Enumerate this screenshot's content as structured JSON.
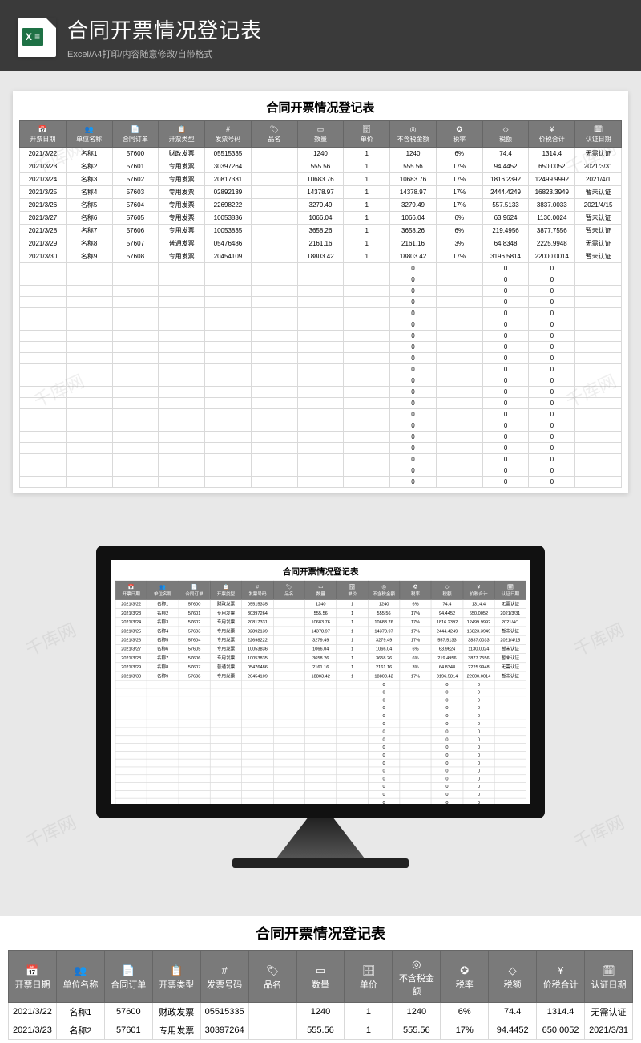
{
  "product": {
    "title": "合同开票情况登记表",
    "subtitle": "Excel/A4打印/内容随意修改/自带格式",
    "badge_text": "X ≡"
  },
  "sheet": {
    "title": "合同开票情况登记表",
    "columns": [
      {
        "icon": "📅",
        "label": "开票日期"
      },
      {
        "icon": "👥",
        "label": "单位名称"
      },
      {
        "icon": "📄",
        "label": "合同订单"
      },
      {
        "icon": "📋",
        "label": "开票类型"
      },
      {
        "icon": "#",
        "label": "发票号码"
      },
      {
        "icon": "🏷",
        "label": "品名"
      },
      {
        "icon": "▭",
        "label": "数量"
      },
      {
        "icon": "🗄",
        "label": "单价"
      },
      {
        "icon": "◎",
        "label": "不含税金额"
      },
      {
        "icon": "✪",
        "label": "税率"
      },
      {
        "icon": "◇",
        "label": "税额"
      },
      {
        "icon": "¥",
        "label": "价税合计"
      },
      {
        "icon": "🗓",
        "label": "认证日期"
      }
    ],
    "rows": [
      {
        "date": "2021/3/22",
        "unit": "名称1",
        "order": "57600",
        "type": "财政发票",
        "inv": "05515335",
        "name": "",
        "qty": "1240",
        "price": "1",
        "amt": "1240",
        "rate": "6%",
        "tax": "74.4",
        "total": "1314.4",
        "cert": "无需认证"
      },
      {
        "date": "2021/3/23",
        "unit": "名称2",
        "order": "57601",
        "type": "专用发票",
        "inv": "30397264",
        "name": "",
        "qty": "555.56",
        "price": "1",
        "amt": "555.56",
        "rate": "17%",
        "tax": "94.4452",
        "total": "650.0052",
        "cert": "2021/3/31"
      },
      {
        "date": "2021/3/24",
        "unit": "名称3",
        "order": "57602",
        "type": "专用发票",
        "inv": "20817331",
        "name": "",
        "qty": "10683.76",
        "price": "1",
        "amt": "10683.76",
        "rate": "17%",
        "tax": "1816.2392",
        "total": "12499.9992",
        "cert": "2021/4/1"
      },
      {
        "date": "2021/3/25",
        "unit": "名称4",
        "order": "57603",
        "type": "专用发票",
        "inv": "02892139",
        "name": "",
        "qty": "14378.97",
        "price": "1",
        "amt": "14378.97",
        "rate": "17%",
        "tax": "2444.4249",
        "total": "16823.3949",
        "cert": "暂未认证"
      },
      {
        "date": "2021/3/26",
        "unit": "名称5",
        "order": "57604",
        "type": "专用发票",
        "inv": "22698222",
        "name": "",
        "qty": "3279.49",
        "price": "1",
        "amt": "3279.49",
        "rate": "17%",
        "tax": "557.5133",
        "total": "3837.0033",
        "cert": "2021/4/15"
      },
      {
        "date": "2021/3/27",
        "unit": "名称6",
        "order": "57605",
        "type": "专用发票",
        "inv": "10053836",
        "name": "",
        "qty": "1066.04",
        "price": "1",
        "amt": "1066.04",
        "rate": "6%",
        "tax": "63.9624",
        "total": "1130.0024",
        "cert": "暂未认证"
      },
      {
        "date": "2021/3/28",
        "unit": "名称7",
        "order": "57606",
        "type": "专用发票",
        "inv": "10053835",
        "name": "",
        "qty": "3658.26",
        "price": "1",
        "amt": "3658.26",
        "rate": "6%",
        "tax": "219.4956",
        "total": "3877.7556",
        "cert": "暂未认证"
      },
      {
        "date": "2021/3/29",
        "unit": "名称8",
        "order": "57607",
        "type": "普通发票",
        "inv": "05476486",
        "name": "",
        "qty": "2161.16",
        "price": "1",
        "amt": "2161.16",
        "rate": "3%",
        "tax": "64.8348",
        "total": "2225.9948",
        "cert": "无需认证"
      },
      {
        "date": "2021/3/30",
        "unit": "名称9",
        "order": "57608",
        "type": "专用发票",
        "inv": "20454109",
        "name": "",
        "qty": "18803.42",
        "price": "1",
        "amt": "18803.42",
        "rate": "17%",
        "tax": "3196.5814",
        "total": "22000.0014",
        "cert": "暂未认证"
      }
    ],
    "empty_row_count": 20,
    "empty_value": "0",
    "bottom_preview_rows": 2
  },
  "watermark": "千库网"
}
